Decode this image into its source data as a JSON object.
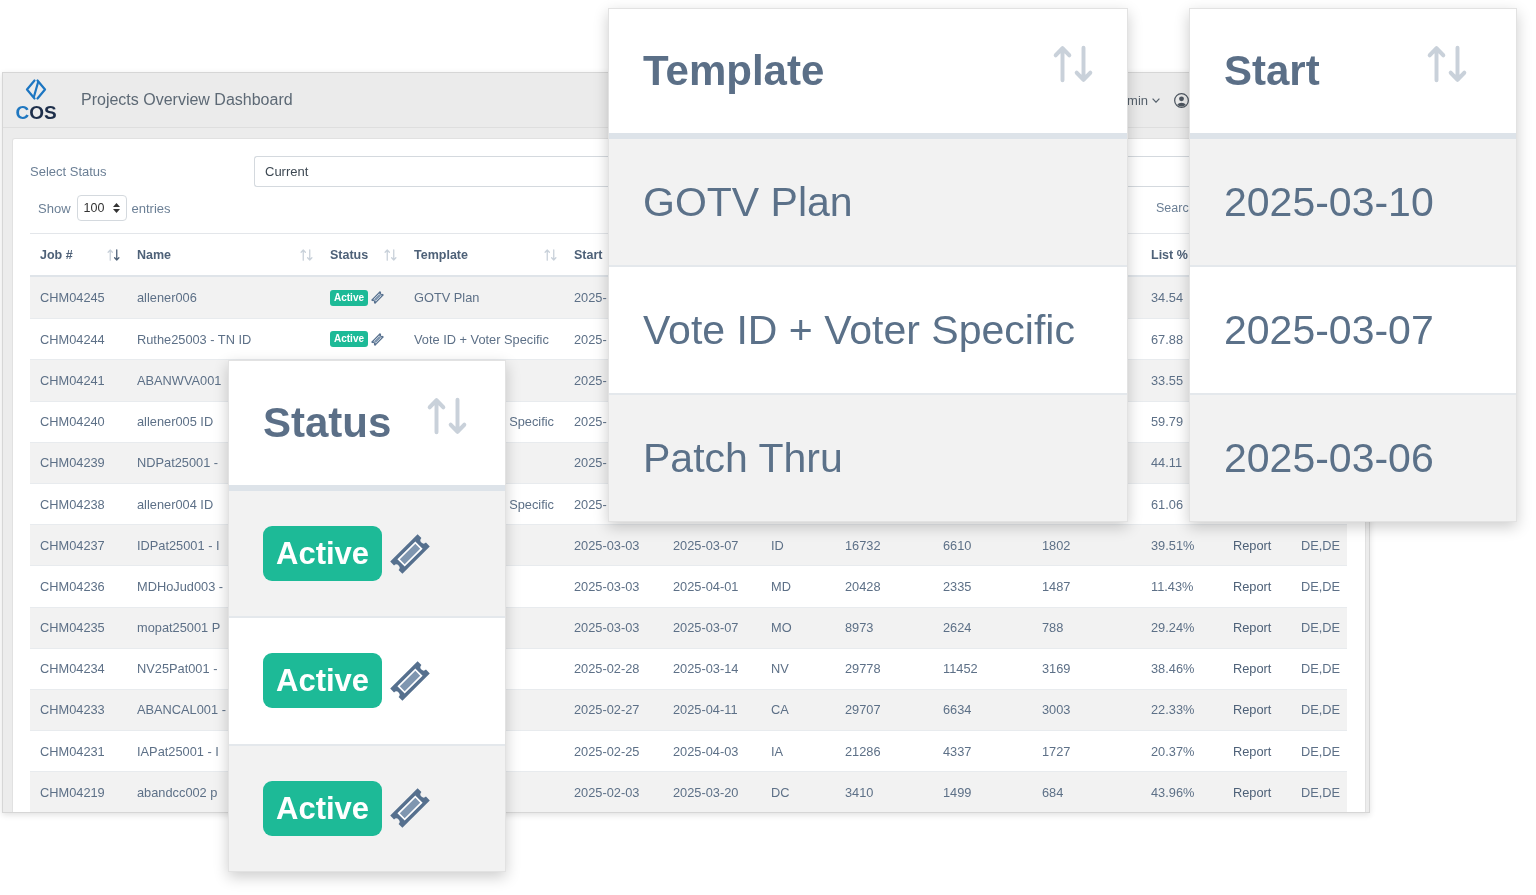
{
  "header": {
    "logo_text": "COS",
    "title": "Projects Overview Dashboard",
    "user_menu": "min"
  },
  "filters": {
    "status_label": "Select Status",
    "status_value": "Current",
    "show_label": "Show",
    "entries_value": "100",
    "entries_label": "entries",
    "search_label": "Searc"
  },
  "table": {
    "columns": [
      {
        "label": "Job #",
        "sorted": true
      },
      {
        "label": "Name",
        "sorted": false
      },
      {
        "label": "Status",
        "sorted": false
      },
      {
        "label": "Template",
        "sorted": false
      },
      {
        "label": "Start"
      },
      {
        "label": "List %"
      }
    ],
    "rows": [
      {
        "job": "CHM04245",
        "name": "allener006",
        "status": "Active",
        "template": "GOTV Plan",
        "start": "2025-",
        "list_pct": "34.54"
      },
      {
        "job": "CHM04244",
        "name": "Ruthe25003 - TN ID",
        "status": "Active",
        "template": "Vote ID + Voter Specific",
        "start": "2025-",
        "list_pct": "67.88"
      },
      {
        "job": "CHM04241",
        "name": "ABANWVA001",
        "start": "2025-",
        "list_pct": "33.55"
      },
      {
        "job": "CHM04240",
        "name": "allener005 ID",
        "template": "Specific",
        "start": "2025-",
        "list_pct": "59.79"
      },
      {
        "job": "CHM04239",
        "name": "NDPat25001 -",
        "start": "2025-",
        "list_pct": "44.11"
      },
      {
        "job": "CHM04238",
        "name": "allener004 ID",
        "template": "Specific",
        "start": "2025-",
        "list_pct": "61.06"
      },
      {
        "job": "CHM04237",
        "name": "IDPat25001 - I",
        "start": "2025-03-03",
        "column_6": "2025-03-07",
        "column_7": "ID",
        "column_8": "16732",
        "column_9": "6610",
        "column_10": "1802",
        "list_pct": "39.51%",
        "column_12": "Report",
        "column_13": "DE,DE"
      },
      {
        "job": "CHM04236",
        "name": "MDHoJud003 -",
        "start": "2025-03-03",
        "column_6": "2025-04-01",
        "column_7": "MD",
        "column_8": "20428",
        "column_9": "2335",
        "column_10": "1487",
        "list_pct": "11.43%",
        "column_12": "Report",
        "column_13": "DE,DE"
      },
      {
        "job": "CHM04235",
        "name": "mopat25001 P",
        "start": "2025-03-03",
        "column_6": "2025-03-07",
        "column_7": "MO",
        "column_8": "8973",
        "column_9": "2624",
        "column_10": "788",
        "list_pct": "29.24%",
        "column_12": "Report",
        "column_13": "DE,DE"
      },
      {
        "job": "CHM04234",
        "name": "NV25Pat001 -",
        "start": "2025-02-28",
        "column_6": "2025-03-14",
        "column_7": "NV",
        "column_8": "29778",
        "column_9": "11452",
        "column_10": "3169",
        "list_pct": "38.46%",
        "column_12": "Report",
        "column_13": "DE,DE"
      },
      {
        "job": "CHM04233",
        "name": "ABANCAL001 -",
        "start": "2025-02-27",
        "column_6": "2025-04-11",
        "column_7": "CA",
        "column_8": "29707",
        "column_9": "6634",
        "column_10": "3003",
        "list_pct": "22.33%",
        "column_12": "Report",
        "column_13": "DE,DE"
      },
      {
        "job": "CHM04231",
        "name": "IAPat25001 - I",
        "start": "2025-02-25",
        "column_6": "2025-04-03",
        "column_7": "IA",
        "column_8": "21286",
        "column_9": "4337",
        "column_10": "1727",
        "list_pct": "20.37%",
        "column_12": "Report",
        "column_13": "DE,DE"
      },
      {
        "job": "CHM04219",
        "name": "abandcc002 p",
        "start": "2025-02-03",
        "column_6": "2025-03-20",
        "column_7": "DC",
        "column_8": "3410",
        "column_9": "1499",
        "column_10": "684",
        "list_pct": "43.96%",
        "column_12": "Report",
        "column_13": "DE,DE"
      }
    ]
  },
  "callouts": [
    {
      "kind": "text",
      "header": "Template",
      "sorted": false,
      "cells": [
        "GOTV Plan",
        "Vote ID + Voter Specific",
        "Patch Thru"
      ]
    },
    {
      "kind": "text",
      "header": "Start",
      "sorted": false,
      "cells": [
        "2025-03-10",
        "2025-03-07",
        "2025-03-06"
      ]
    },
    {
      "kind": "status",
      "header": "Status",
      "sorted": false,
      "cells": [
        "Active",
        "Active",
        "Active"
      ]
    }
  ]
}
